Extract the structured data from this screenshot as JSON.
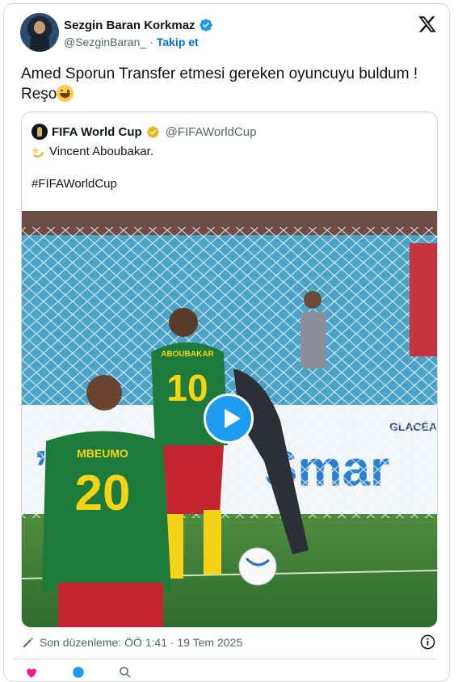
{
  "author": {
    "display_name": "Sezgin Baran Korkmaz",
    "handle": "@SezginBaran_",
    "separator": "·",
    "follow_label": "Takip et"
  },
  "tweet": {
    "text": "Amed Sporun Transfer etmesi gereken oyuncuyu buldum ! Reşo",
    "emoji": "grinning-face"
  },
  "quoted": {
    "display_name": "FIFA World Cup",
    "handle": "@FIFAWorldCup",
    "line1": "Vincent Aboubakar.",
    "line2": "#FIFAWorldCup",
    "video": {
      "player_10_name": "ABOUBAKAR",
      "player_10_number": "10",
      "player_20_name": "MBEUMO",
      "player_20_number": "20",
      "ad_board_brand": "GLACÉAU"
    }
  },
  "edited_text": "Son düzenleme: ÖÖ 1:41 · 19 Tem 2025",
  "colors": {
    "accent": "#1d9bf0",
    "follow": "#006fd6",
    "muted": "#536471",
    "kit_green": "#1e7a3a",
    "kit_yellow": "#f5d316"
  },
  "icons": [
    "verified-icon",
    "x-logo-icon",
    "gold-verified-icon",
    "dizzy-icon",
    "play-icon",
    "pencil-icon",
    "info-icon",
    "heart-icon",
    "reply-icon",
    "search-icon"
  ]
}
